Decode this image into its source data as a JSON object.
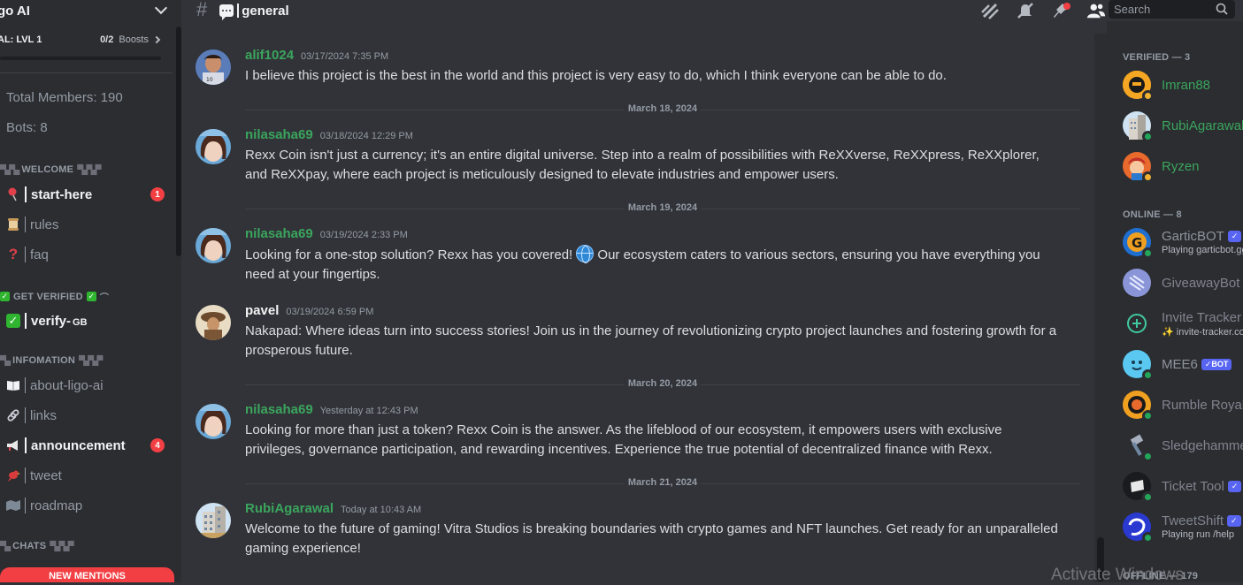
{
  "server": {
    "name": "go AI",
    "boost_level": "AL: LVL 1",
    "boost_count": "0/2",
    "boost_label": "Boosts"
  },
  "stats": {
    "total_members": "Total Members: 190",
    "bots": "Bots: 8"
  },
  "categories": {
    "welcome": "WELCOME",
    "verify": "GET VERIFIED",
    "info": "INFOMATION",
    "chats": "CHATS"
  },
  "channels": [
    {
      "name": "start-here",
      "icon": "pin-icon",
      "badge": "1",
      "unread": true
    },
    {
      "name": "rules",
      "icon": "scroll-icon",
      "badge": "",
      "unread": false
    },
    {
      "name": "faq",
      "icon": "question-icon",
      "badge": "",
      "unread": false
    },
    {
      "name": "verify-",
      "suffix": "GB",
      "icon": "check-icon",
      "badge": "",
      "unread": true
    },
    {
      "name": "about-ligo-ai",
      "icon": "book-icon",
      "badge": "",
      "unread": false
    },
    {
      "name": "links",
      "icon": "link-icon",
      "badge": "",
      "unread": false
    },
    {
      "name": "announcement",
      "icon": "megaphone-icon",
      "badge": "4",
      "unread": true
    },
    {
      "name": "tweet",
      "icon": "bird-icon",
      "badge": "",
      "unread": false
    },
    {
      "name": "roadmap",
      "icon": "map-icon",
      "badge": "",
      "unread": false
    }
  ],
  "new_mentions": "NEW MENTIONS",
  "topbar": {
    "channel": "general",
    "search_placeholder": "Search"
  },
  "messages": [
    {
      "user": "alif1024",
      "time": "03/17/2024 7:35 PM",
      "color": "#3ba55d",
      "text": "I believe this project is the best in the world and this project is very easy to do, which I think everyone can be able to do."
    },
    {
      "divider": "March 18, 2024"
    },
    {
      "user": "nilasaha69",
      "time": "03/18/2024 12:29 PM",
      "color": "#3ba55d",
      "text": "Rexx Coin isn't just a currency; it's an entire digital universe. Step into a realm of possibilities with ReXXverse, ReXXpress, ReXXplorer, and ReXXpay, where each project is meticulously designed to elevate industries and empower users."
    },
    {
      "divider": "March 19, 2024"
    },
    {
      "user": "nilasaha69",
      "time": "03/19/2024 2:33 PM",
      "color": "#3ba55d",
      "text_a": "Looking for a one-stop solution? Rexx has you covered!",
      "text_b": "Our ecosystem caters to various sectors, ensuring you have everything you need at your fingertips."
    },
    {
      "user": "pavel",
      "time": "03/19/2024 6:59 PM",
      "color": "#f2f3f5",
      "text": "Nakapad: Where ideas turn into success stories! Join us in the journey of revolutionizing crypto project launches and fostering growth for a prosperous future."
    },
    {
      "divider": "March 20, 2024"
    },
    {
      "user": "nilasaha69",
      "time": "Yesterday at 12:43 PM",
      "color": "#3ba55d",
      "text": "Looking for more than just a token? Rexx Coin is the answer. As the lifeblood of our ecosystem, it empowers users with exclusive privileges, governance participation, and rewarding incentives. Experience the true potential of decentralized finance with Rexx."
    },
    {
      "divider": "March 21, 2024"
    },
    {
      "user": "RubiAgarawal",
      "time": "Today at 10:43 AM",
      "color": "#3ba55d",
      "text": "Welcome to the future of gaming! Vitra Studios is breaking boundaries with crypto games and NFT launches. Get ready for an unparalleled gaming experience!"
    }
  ],
  "members": {
    "verified_header": "VERIFIED — 3",
    "online_header": "ONLINE — 8",
    "offline_header": "OFFLINE — 179",
    "verified": [
      {
        "name": "Imran88",
        "color": "#3ba55d"
      },
      {
        "name": "RubiAgarawal",
        "color": "#3ba55d"
      },
      {
        "name": "Ryzen",
        "color": "#3ba55d"
      }
    ],
    "online": [
      {
        "name": "GarticBOT",
        "sub": "Playing garticbot.gg",
        "bot": true
      },
      {
        "name": "GiveawayBot",
        "sub": "",
        "bot": false
      },
      {
        "name": "Invite Tracker",
        "sub": "✨ invite-tracker.com",
        "bot": false
      },
      {
        "name": "MEE6",
        "sub": "",
        "bot": true
      },
      {
        "name": "Rumble Royale",
        "sub": "",
        "bot": false
      },
      {
        "name": "Sledgehammer",
        "sub": "",
        "bot": false
      },
      {
        "name": "Ticket Tool",
        "sub": "",
        "bot": true
      },
      {
        "name": "TweetShift",
        "sub": "Playing run /help",
        "bot": true
      }
    ],
    "bot_label": "BOT"
  },
  "watermark": "Activate Windows"
}
